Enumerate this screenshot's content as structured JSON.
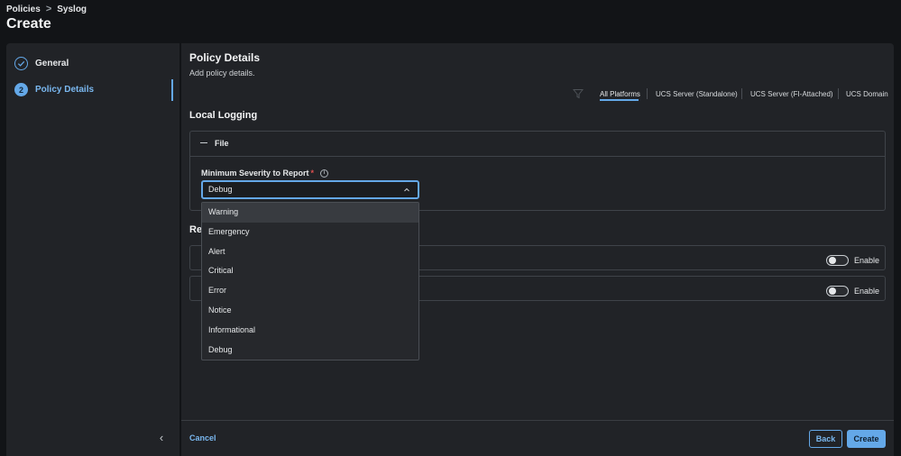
{
  "breadcrumb": {
    "items": [
      "Policies",
      "Syslog"
    ],
    "separator": ">"
  },
  "page": {
    "title": "Create"
  },
  "steps": [
    {
      "label": "General",
      "number": "✓",
      "state": "done"
    },
    {
      "label": "Policy Details",
      "number": "2",
      "state": "active"
    }
  ],
  "panel": {
    "title": "Policy Details",
    "subtitle": "Add policy details."
  },
  "platform_tabs": [
    {
      "label": "All Platforms",
      "selected": true
    },
    {
      "label": "UCS Server (Standalone)"
    },
    {
      "label": "UCS Server (FI-Attached)"
    },
    {
      "label": "UCS Domain"
    }
  ],
  "local_logging": {
    "heading": "Local Logging",
    "file_label": "File",
    "severity_label": "Minimum Severity to Report",
    "required_mark": "*",
    "info_glyph": "i",
    "selected_value": "Debug",
    "options": [
      "Warning",
      "Emergency",
      "Alert",
      "Critical",
      "Error",
      "Notice",
      "Informational",
      "Debug"
    ]
  },
  "remote_logging": {
    "heading": "Re",
    "rows": [
      {
        "toggle_label": "Enable"
      },
      {
        "toggle_label": "Enable"
      }
    ]
  },
  "footer": {
    "cancel": "Cancel",
    "back": "Back",
    "create": "Create",
    "collapse_glyph": "‹"
  },
  "colors": {
    "accent": "#64a8e8",
    "background": "#121417",
    "panel": "#212327",
    "required": "#e05050"
  }
}
